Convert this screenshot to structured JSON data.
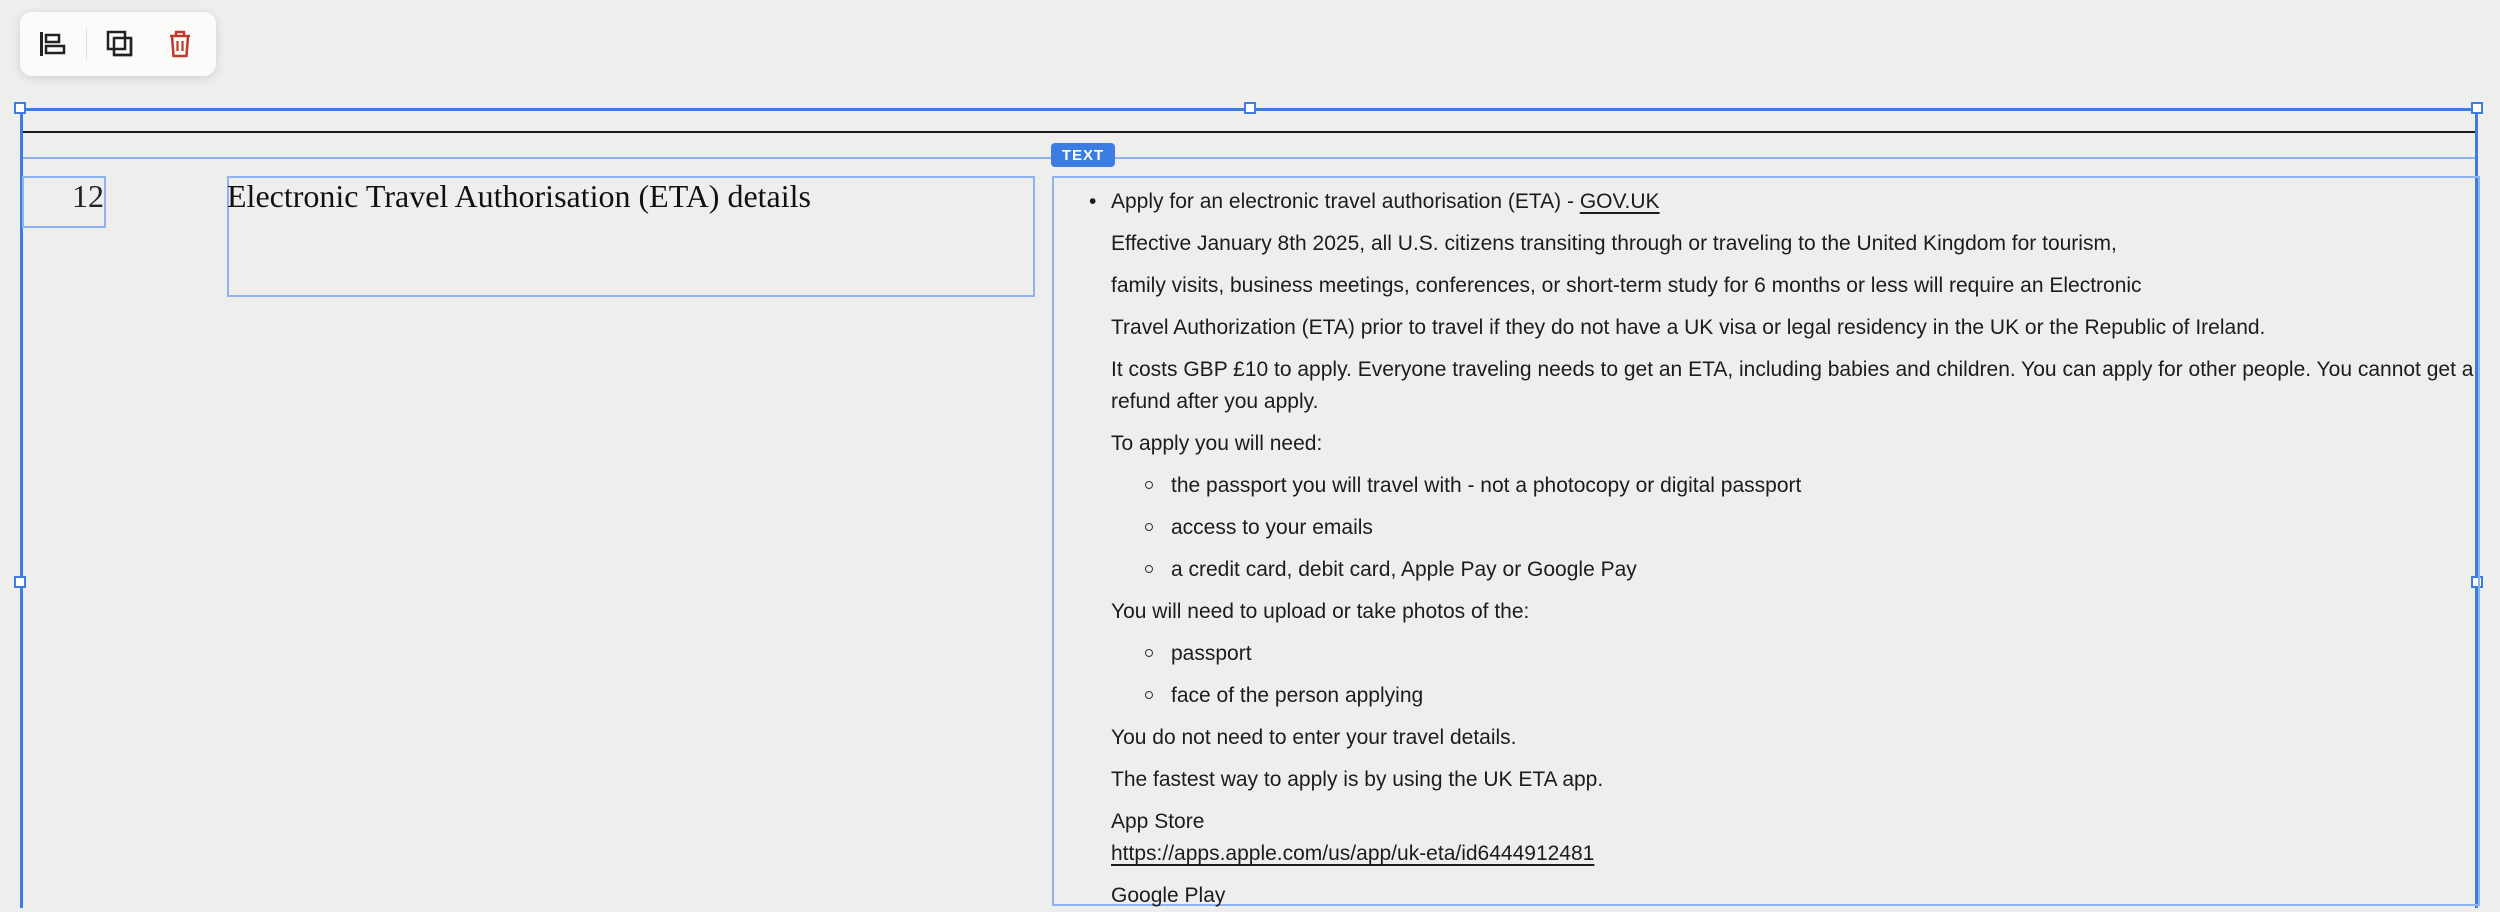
{
  "toolbar": {
    "align_icon": "align-left-icon",
    "duplicate_icon": "duplicate-icon",
    "delete_icon": "trash-icon",
    "delete_color": "#c0392b"
  },
  "selection": {
    "badge": "TEXT",
    "accent_color": "#3b7de3"
  },
  "row": {
    "number": "12",
    "title": "Electronic Travel Authorisation (ETA) details"
  },
  "content": {
    "headline_text": "Apply for an electronic travel authorisation (ETA) - ",
    "headline_link": "GOV.UK",
    "para1_line1": "Effective January 8th 2025, all U.S. citizens transiting through or traveling to the United Kingdom for tourism,",
    "para1_line2": "family visits, business meetings, conferences, or short-term study for 6 months or less will require an Electronic",
    "para1_line3": "Travel Authorization (ETA) prior to travel if they do not have a UK visa or legal residency in the UK or the Republic of Ireland.",
    "para2_line1": "It costs GBP £10 to apply. Everyone traveling needs to get an ETA, including babies and children. You can apply for other people. You cannot get a",
    "para2_line2": "refund after you apply.",
    "need_heading": "To apply you will need:",
    "need_items": [
      "the passport you will travel with - not a photocopy or digital passport",
      "access to your emails",
      "a credit card, debit card, Apple Pay or Google Pay"
    ],
    "upload_heading": "You will need to upload or take photos of the:",
    "upload_items": [
      "passport",
      "face of the person applying"
    ],
    "no_travel": "You do not need to enter your travel details.",
    "fastest": "The fastest way to apply is by using the UK ETA app.",
    "app_store_label": "App Store",
    "app_store_url": "https://apps.apple.com/us/app/uk-eta/id6444912481",
    "google_play_label": "Google Play"
  }
}
